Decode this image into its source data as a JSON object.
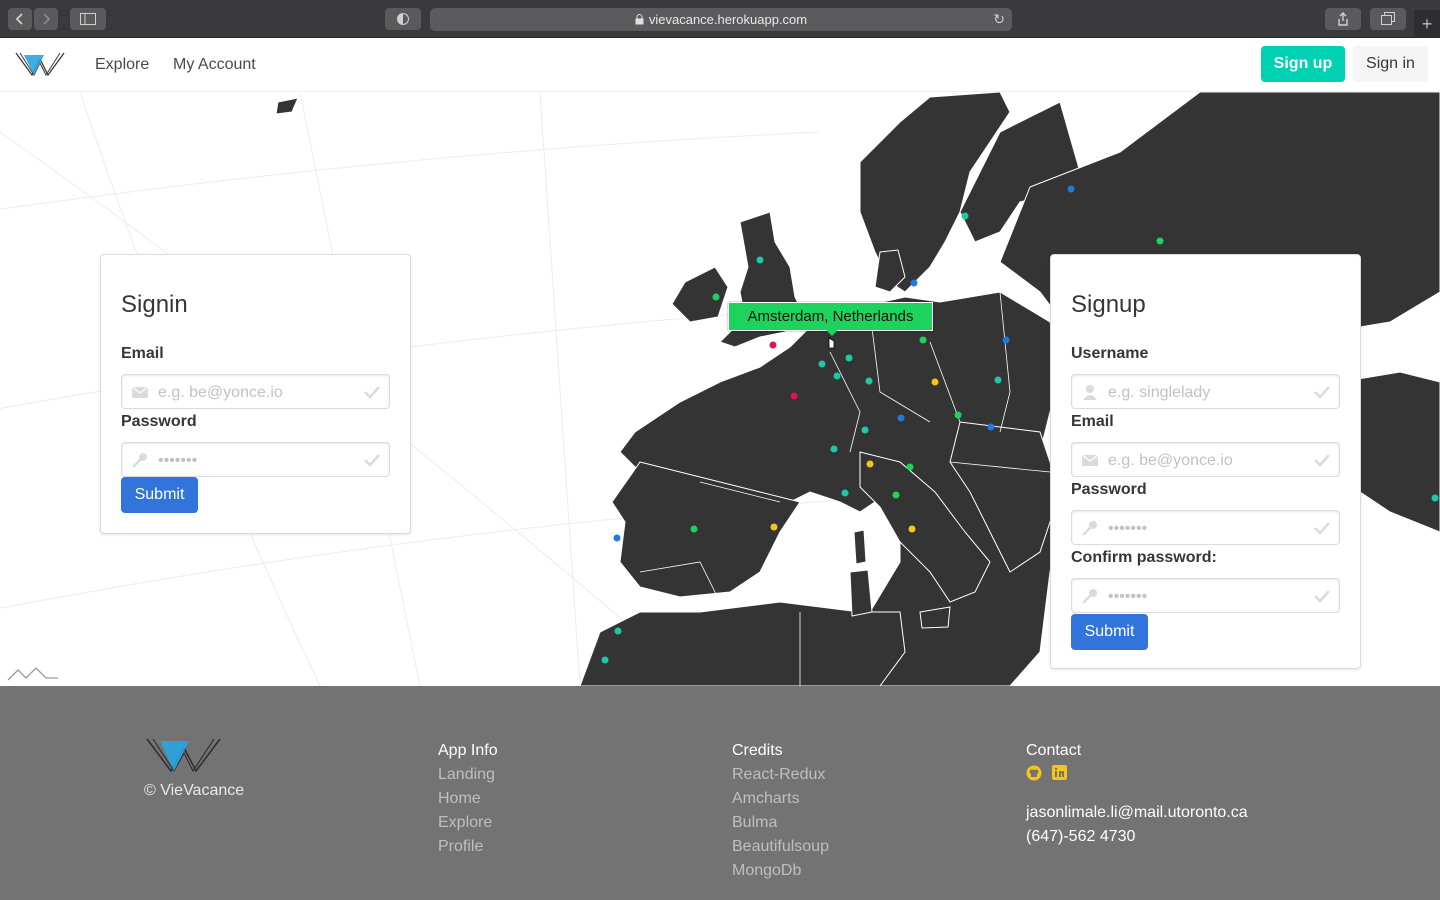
{
  "browser": {
    "url": "vievacance.herokuapp.com"
  },
  "navbar": {
    "links": [
      "Explore",
      "My Account"
    ],
    "signup": "Sign up",
    "signin": "Sign in"
  },
  "map": {
    "tooltip": "Amsterdam, Netherlands",
    "colors": {
      "land": "#353435",
      "water": "#ffffff",
      "tooltip": "#1dd35c"
    }
  },
  "signin": {
    "title": "Signin",
    "email_label": "Email",
    "email_placeholder": "e.g. be@yonce.io",
    "password_label": "Password",
    "password_placeholder": "•••••••",
    "submit": "Submit"
  },
  "signup": {
    "title": "Signup",
    "username_label": "Username",
    "username_placeholder": "e.g. singlelady",
    "email_label": "Email",
    "email_placeholder": "e.g. be@yonce.io",
    "password_label": "Password",
    "password_placeholder": "•••••••",
    "confirm_label": "Confirm password:",
    "confirm_placeholder": "•••••••",
    "submit": "Submit"
  },
  "footer": {
    "copyright": "© VieVacance",
    "app_info": {
      "title": "App Info",
      "links": [
        "Landing",
        "Home",
        "Explore",
        "Profile"
      ]
    },
    "credits": {
      "title": "Credits",
      "links": [
        "React-Redux",
        "Amcharts",
        "Bulma",
        "Beautifulsoup",
        "MongoDb"
      ]
    },
    "contact": {
      "title": "Contact",
      "email": "jasonlimale.li@mail.utoronto.ca",
      "phone": "(647)-562 4730",
      "icons": [
        "github-icon",
        "linkedin-icon"
      ]
    }
  },
  "colors": {
    "accent": "#00d1b2",
    "primary": "#3273dc",
    "footer_bg": "#747374",
    "social": "#f5c518"
  }
}
